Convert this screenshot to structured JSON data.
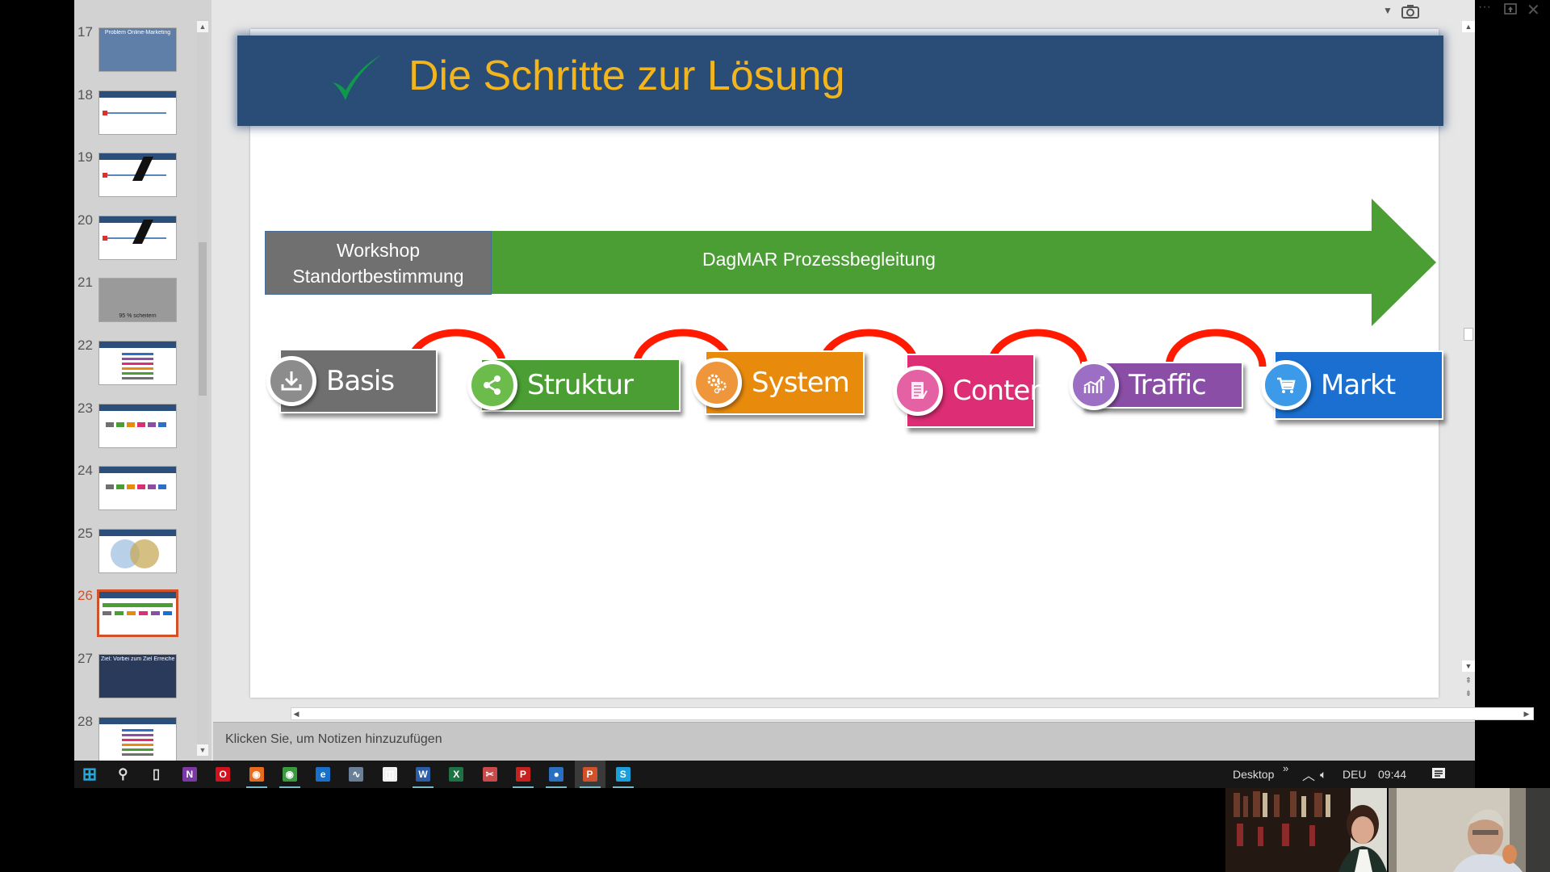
{
  "thumbnails": [
    {
      "number": "17",
      "caption": "Problem Online-Marketing",
      "kind": "photo",
      "bg": "#5f7fa8"
    },
    {
      "number": "18",
      "caption": "",
      "kind": "timeline",
      "bg": "#ffffff"
    },
    {
      "number": "19",
      "caption": "",
      "kind": "timeline-lightning",
      "bg": "#ffffff"
    },
    {
      "number": "20",
      "caption": "",
      "kind": "timeline-lightning",
      "bg": "#ffffff"
    },
    {
      "number": "21",
      "caption": "95 % scheitern",
      "kind": "photo",
      "bg": "#9a9a9a"
    },
    {
      "number": "22",
      "caption": "",
      "kind": "list",
      "bg": "#ffffff"
    },
    {
      "number": "23",
      "caption": "",
      "kind": "people",
      "bg": "#ffffff"
    },
    {
      "number": "24",
      "caption": "",
      "kind": "people",
      "bg": "#ffffff"
    },
    {
      "number": "25",
      "caption": "",
      "kind": "venn",
      "bg": "#ffffff"
    },
    {
      "number": "26",
      "caption": "",
      "kind": "process",
      "bg": "#ffffff",
      "active": true
    },
    {
      "number": "27",
      "caption": "Ziel: Vorbei zum Ziel Erreichen",
      "kind": "photo",
      "bg": "#2a3a5a"
    },
    {
      "number": "28",
      "caption": "",
      "kind": "list",
      "bg": "#ffffff"
    }
  ],
  "slide": {
    "title": "Die Schritte zur Lösung",
    "title_icon": "checkmark-icon",
    "colors": {
      "banner": "#2a4d78",
      "title_text": "#f2b51d",
      "check": "#0e9a4a",
      "arrow": "#4a9e34",
      "workshop": "#707070",
      "arc": "#ff1a00"
    },
    "workshop": {
      "line1": "Workshop",
      "line2": "Standortbestimmung"
    },
    "process_label": "DagMAR Prozessbegleitung",
    "steps": [
      {
        "label": "Basis",
        "icon": "download-icon",
        "color": "#6f6f6f",
        "icon_color": "#8c8c8c"
      },
      {
        "label": "Struktur",
        "icon": "share-icon",
        "color": "#4a9e34",
        "icon_color": "#6cbc4c"
      },
      {
        "label": "System",
        "icon": "gears-icon",
        "color": "#e88a0c",
        "icon_color": "#f0963a"
      },
      {
        "label": "Content",
        "icon": "document-icon",
        "color": "#dc2d75",
        "icon_color": "#e461a3"
      },
      {
        "label": "Traffic",
        "icon": "chart-trend-icon",
        "color": "#8a4ea6",
        "icon_color": "#9c6ec4"
      },
      {
        "label": "Markt",
        "icon": "cart-icon",
        "color": "#1a6fd0",
        "icon_color": "#3c9ae8"
      }
    ]
  },
  "notes": {
    "placeholder": "Klicken Sie, um Notizen hinzuzufügen"
  },
  "window_controls": {
    "dropdown": "chevron-down-icon",
    "screenshot": "camera-icon",
    "more": "more-icon",
    "restore": "restore-icon",
    "close": "close-icon"
  },
  "taskbar": {
    "apps": [
      {
        "name": "start",
        "glyph": "⊞",
        "color": "#2aa7d6",
        "running": false
      },
      {
        "name": "search",
        "glyph": "⚲",
        "color": "transparent",
        "running": false
      },
      {
        "name": "task-view",
        "glyph": "▯",
        "color": "transparent",
        "running": false
      },
      {
        "name": "onenote",
        "glyph": "N",
        "color": "#7b3aa3",
        "running": false
      },
      {
        "name": "opera",
        "glyph": "O",
        "color": "#d0121f",
        "running": false
      },
      {
        "name": "firefox",
        "glyph": "◉",
        "color": "#e86a1c",
        "running": true
      },
      {
        "name": "chrome",
        "glyph": "◉",
        "color": "#3a9a3e",
        "running": true
      },
      {
        "name": "edge",
        "glyph": "e",
        "color": "#1a70c8",
        "running": false
      },
      {
        "name": "monitor",
        "glyph": "∿",
        "color": "#6a8098",
        "running": false
      },
      {
        "name": "store",
        "glyph": "◫",
        "color": "#f0f0f0",
        "running": false
      },
      {
        "name": "word",
        "glyph": "W",
        "color": "#2b5ca8",
        "running": true
      },
      {
        "name": "excel",
        "glyph": "X",
        "color": "#1e7344",
        "running": false
      },
      {
        "name": "snipping",
        "glyph": "✂",
        "color": "#c84a4a",
        "running": false
      },
      {
        "name": "pdf",
        "glyph": "P",
        "color": "#c6201f",
        "running": true
      },
      {
        "name": "chat",
        "glyph": "●",
        "color": "#2a6fc0",
        "running": true
      },
      {
        "name": "powerpoint",
        "glyph": "P",
        "color": "#d0512a",
        "running": true,
        "active": true
      },
      {
        "name": "skype",
        "glyph": "S",
        "color": "#1b9fdb",
        "running": true
      }
    ],
    "tray": {
      "desktop_label": "Desktop",
      "overflow": "»",
      "language": "DEU",
      "time": "09:44"
    }
  }
}
